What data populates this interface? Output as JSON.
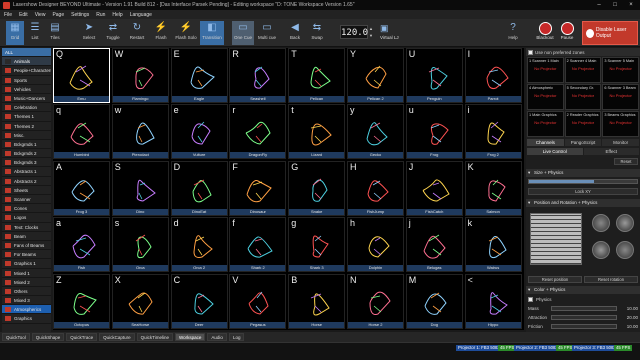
{
  "titlebar": {
    "title": "Lasershow Designer BEYOND Ultimate - Version 1.91 Build 812 - [Das Interface Parsek Pending] - Editing workspace \"D: TONE Workspace Version 1.65\""
  },
  "menu": [
    "File",
    "Edit",
    "View",
    "Page",
    "Settings",
    "Run",
    "Help",
    "Language"
  ],
  "toolbar": {
    "buttons": [
      "Grid",
      "List",
      "Tiles",
      "Select",
      "Toggle",
      "Restart",
      "Flash",
      "Flash Solo",
      "Transition",
      "One Cue",
      "Multi cue",
      "Back",
      "Swap"
    ],
    "bpm": "120.0",
    "virtual_label": "Virtual LJ",
    "help": "Help",
    "blackout": "Blackout",
    "pause": "Pause",
    "disable_laser": "Disable Laser Output"
  },
  "sidebar": {
    "all_label": "ALL",
    "items": [
      {
        "label": "Animals",
        "color": "#2a2a2a",
        "selected": true
      },
      {
        "label": "People+Characters",
        "color": "#c0392b"
      },
      {
        "label": "Sports",
        "color": "#c0392b"
      },
      {
        "label": "Vehicles",
        "color": "#c0392b"
      },
      {
        "label": "Music+Dancers",
        "color": "#c0392b"
      },
      {
        "label": "Celebration",
        "color": "#c0392b"
      },
      {
        "label": "Themes 1",
        "color": "#c0392b"
      },
      {
        "label": "Themes 2",
        "color": "#c0392b"
      },
      {
        "label": "Misc.",
        "color": "#c0392b"
      },
      {
        "label": "Bckgrnds 1",
        "color": "#c0392b"
      },
      {
        "label": "Bckgrnds 2",
        "color": "#c0392b"
      },
      {
        "label": "Bckgrnds 3",
        "color": "#c0392b"
      },
      {
        "label": "Abstracts 1",
        "color": "#c0392b"
      },
      {
        "label": "Abstracts 2",
        "color": "#c0392b"
      },
      {
        "label": "Sheets",
        "color": "#c0392b"
      },
      {
        "label": "Scanner",
        "color": "#c0392b"
      },
      {
        "label": "Cones",
        "color": "#c0392b"
      },
      {
        "label": "Logos",
        "color": "#c0392b"
      },
      {
        "label": "Text: Clocks",
        "color": "#c0392b"
      },
      {
        "label": "Beam",
        "color": "#c0392b"
      },
      {
        "label": "Fans of Beams",
        "color": "#c0392b"
      },
      {
        "label": "For Beams",
        "color": "#c0392b"
      },
      {
        "label": "Graphics 1",
        "color": "#c0392b"
      },
      {
        "label": "Mixed 1",
        "color": "#c0392b"
      },
      {
        "label": "Mixed 2",
        "color": "#c0392b"
      },
      {
        "label": "Others",
        "color": "#c0392b"
      },
      {
        "label": "Mixed 3",
        "color": "#c0392b"
      },
      {
        "label": "Atmospherics",
        "color": "#c0392b",
        "atm": true
      },
      {
        "label": "Graphics",
        "color": "#c0392b"
      }
    ]
  },
  "grid": {
    "rows": [
      [
        {
          "k": "Q",
          "n": "Emu"
        },
        {
          "k": "W",
          "n": "Flamingo"
        },
        {
          "k": "E",
          "n": "Eagle"
        },
        {
          "k": "R",
          "n": "Seashell"
        },
        {
          "k": "T",
          "n": "Pelican"
        },
        {
          "k": "Y",
          "n": "Pelican 2"
        },
        {
          "k": "U",
          "n": "Penguin"
        },
        {
          "k": "I",
          "n": "Parrot"
        }
      ],
      [
        {
          "k": "q",
          "n": "Humbird"
        },
        {
          "k": "w",
          "n": "Pterodact"
        },
        {
          "k": "e",
          "n": "Vulture"
        },
        {
          "k": "r",
          "n": "DragonFly"
        },
        {
          "k": "t",
          "n": "Lizard"
        },
        {
          "k": "y",
          "n": "Gecko"
        },
        {
          "k": "u",
          "n": "Frog"
        },
        {
          "k": "i",
          "n": "Frog 2"
        }
      ],
      [
        {
          "k": "A",
          "n": "Frog 3"
        },
        {
          "k": "S",
          "n": "Dino"
        },
        {
          "k": "D",
          "n": "DinoEat"
        },
        {
          "k": "F",
          "n": "Dinosaur"
        },
        {
          "k": "G",
          "n": "Snake"
        },
        {
          "k": "H",
          "n": "FishJump"
        },
        {
          "k": "J",
          "n": "FishCatch"
        },
        {
          "k": "K",
          "n": "Salmon"
        }
      ],
      [
        {
          "k": "a",
          "n": "Fish"
        },
        {
          "k": "s",
          "n": "Orca"
        },
        {
          "k": "d",
          "n": "Orca 2"
        },
        {
          "k": "f",
          "n": "Shark 2"
        },
        {
          "k": "g",
          "n": "Shark 3"
        },
        {
          "k": "h",
          "n": "Dolphin"
        },
        {
          "k": "j",
          "n": "Belugas"
        },
        {
          "k": "k",
          "n": "Walrus"
        }
      ],
      [
        {
          "k": "Z",
          "n": "Octopus"
        },
        {
          "k": "X",
          "n": "SeaHorse"
        },
        {
          "k": "C",
          "n": "Deer"
        },
        {
          "k": "V",
          "n": "Pegasus"
        },
        {
          "k": "B",
          "n": "Horse"
        },
        {
          "k": "N",
          "n": "Horse 2"
        },
        {
          "k": "M",
          "n": "Dog"
        },
        {
          "k": "<",
          "n": "Hippo"
        }
      ]
    ]
  },
  "right": {
    "use_zones": "Use non preferred zones",
    "zones": [
      {
        "n": "1 Scanner 1 Main",
        "np": "No Projector"
      },
      {
        "n": "2 Scanner 4 Main",
        "np": "No Projector"
      },
      {
        "n": "3 Scanner 5 Main",
        "np": "No Projector"
      },
      {
        "n": "4 Atmospheric",
        "np": "No Projector"
      },
      {
        "n": "5 Secondary Gr.",
        "np": "No Projector"
      },
      {
        "n": "6 Scanner 3 Beam",
        "np": "No Projector"
      },
      {
        "n": "1 Main Graphics",
        "np": "No Projector"
      },
      {
        "n": "2 Reader Graphics",
        "np": "No Projector"
      },
      {
        "n": "3 Beams Graphics",
        "np": "No Projector"
      }
    ],
    "tabs1": [
      "Channels",
      "PangoScript",
      "Monitor"
    ],
    "tabs2": [
      "Live Control",
      "Effect"
    ],
    "reset": "Reset",
    "size_section": "Size + Physics",
    "lock_xy": "Lock XY",
    "position_section": "Position and Rotation + Physics",
    "reset_position": "Reset position",
    "reset_rotation": "Reset rotation",
    "color_section": "Color + Physics",
    "physics": "Physics",
    "params": [
      {
        "n": "Mass",
        "v": "10.00"
      },
      {
        "n": "Attraction",
        "v": "20.00"
      },
      {
        "n": "Friction",
        "v": "10.00"
      }
    ]
  },
  "bottom": {
    "tabs": [
      "QuickTool",
      "QuickShape",
      "QuickTrace",
      "QuickCapture",
      "QuickTimeline",
      "Workspace",
      "Audio",
      "Log"
    ],
    "active": "Workspace"
  },
  "status": {
    "p1": "Projector 1: FB3 50830",
    "p2": "Projector 2: FB3 50831",
    "p3": "Projector 3: FB3 50832",
    "fps1": "45 FPS",
    "fps2": "45 FPS",
    "fps3": "45 FPS",
    "tiny": "1"
  }
}
